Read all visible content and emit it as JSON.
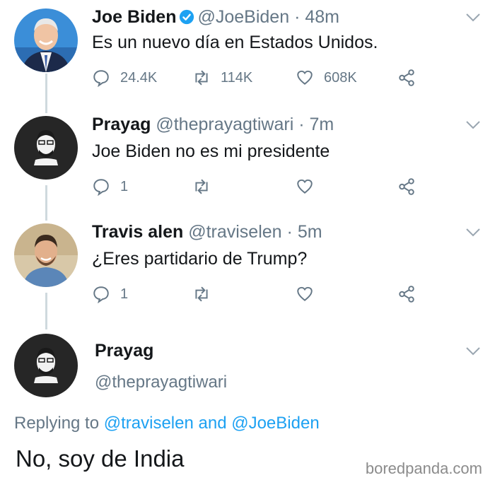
{
  "tweets": [
    {
      "name": "Joe Biden",
      "handle": "@JoeBiden",
      "time": "48m",
      "text": "Es un nuevo día en Estados Unidos.",
      "replies": "24.4K",
      "retweets": "114K",
      "likes": "608K",
      "verified": true
    },
    {
      "name": "Prayag",
      "handle": "@theprayagtiwari",
      "time": "7m",
      "text": "Joe Biden no es mi presidente",
      "replies": "1",
      "retweets": "",
      "likes": ""
    },
    {
      "name": "Travis alen",
      "handle": "@traviselen",
      "time": "5m",
      "text": "¿Eres partidario de Trump?",
      "replies": "1",
      "retweets": "",
      "likes": ""
    }
  ],
  "final_tweet": {
    "name": "Prayag",
    "handle": "@theprayagtiwari",
    "replying_prefix": "Replying to",
    "reply_to_1": "@traviselen",
    "reply_and": "and",
    "reply_to_2": "@JoeBiden",
    "text": "No, soy de India"
  },
  "separator_dot": "·",
  "watermark": "boredpanda.com",
  "colors": {
    "accent": "#1da1f2",
    "muted": "#657786",
    "text": "#14171a",
    "thread_line": "#cfd9de"
  }
}
